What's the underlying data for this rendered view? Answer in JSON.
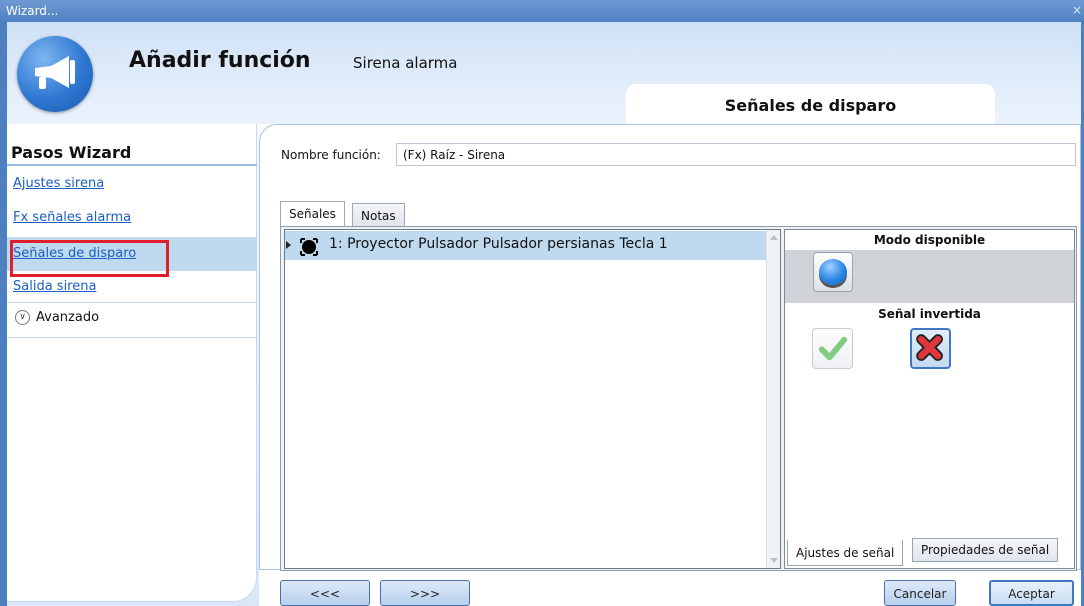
{
  "window": {
    "title": "Wizard...",
    "close_glyph": "×"
  },
  "header": {
    "title": "Añadir función",
    "subtitle": "Sirena alarma",
    "step_banner": "Señales de disparo",
    "logo_icon": "megaphone-icon"
  },
  "sidebar": {
    "title": "Pasos Wizard",
    "items": [
      {
        "label": "Ajustes sirena"
      },
      {
        "label": "Fx señales alarma"
      },
      {
        "label": "Señales de disparo",
        "active": true,
        "highlighted": true
      },
      {
        "label": "Salida sirena"
      }
    ],
    "advanced": {
      "label": "Avanzado",
      "icon": "chevron-down-circle-icon"
    }
  },
  "form": {
    "name_label": "Nombre función:",
    "name_value": "(Fx) Raíz - Sirena"
  },
  "tabs": {
    "signals": "Señales",
    "notes": "Notas"
  },
  "signal_list": {
    "rows": [
      {
        "label": "1: Proyector Pulsador Pulsador persianas Tecla 1",
        "icon": "pushbutton-icon"
      }
    ]
  },
  "properties": {
    "mode_header": "Modo disponible",
    "mode_icon": "blue-pushbutton-icon",
    "inverted_header": "Señal invertida",
    "inverted_options": [
      {
        "icon": "checkmark-icon",
        "selected": false
      },
      {
        "icon": "red-x-icon",
        "selected": true
      }
    ],
    "bottom_tabs": {
      "settings": "Ajustes de señal",
      "properties": "Propiedades de señal"
    }
  },
  "footer": {
    "prev_label": "<<<",
    "next_label": ">>>",
    "cancel_label": "Cancelar",
    "accept_label": "Aceptar"
  },
  "colors": {
    "accent": "#3f78c0",
    "selection": "#bfd9ef",
    "highlight_box": "#e01f2a",
    "link": "#1b5fc3"
  }
}
